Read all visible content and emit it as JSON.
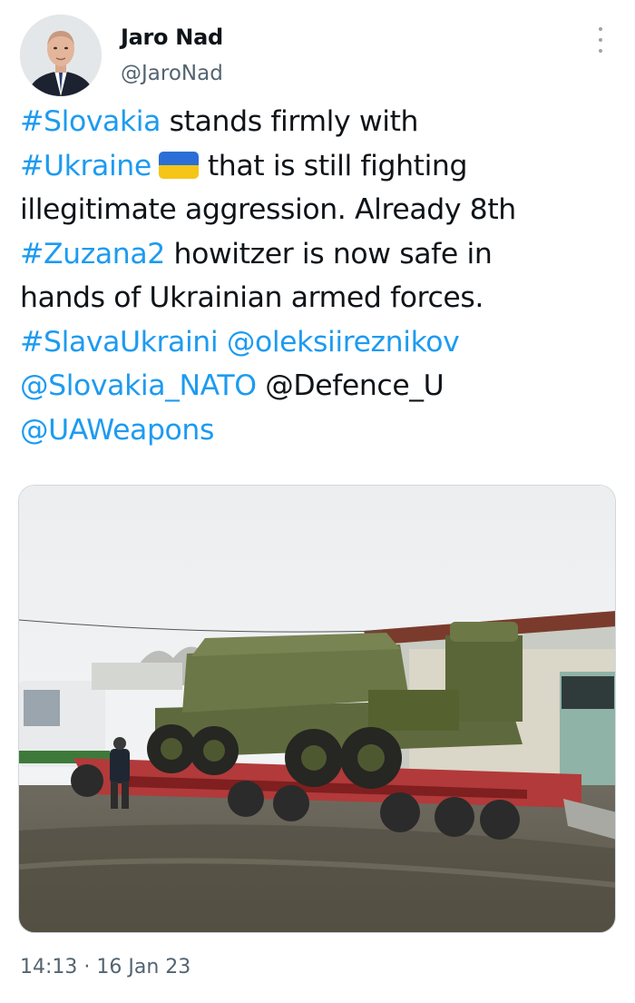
{
  "author": {
    "name": "Jaro Nad",
    "handle": "@JaroNad"
  },
  "tweet": {
    "segments": {
      "tag_slovakia": "#Slovakia",
      "text_1": " stands firmly with",
      "tag_ukraine": "#Ukraine",
      "flag_icon": "ukraine-flag-emoji",
      "text_2": "that is still fighting",
      "text_3": "illegitimate aggression. Already 8th",
      "tag_zuzana2": "#Zuzana2",
      "text_4": " howitzer is now safe in",
      "text_5": "hands of Ukrainian armed forces.",
      "tag_slavaukraini": "#SlavaUkraini",
      "mention_oleksii": "@oleksiireznikov",
      "mention_slovakia_nato": "@Slovakia_NATO",
      "text_6": " @Defence_U",
      "mention_uaweapons": "@UAWeapons"
    }
  },
  "media": {
    "alt": "Zuzana 2 howitzer on a low-loader truck trailer"
  },
  "timestamp": "14:13 · 16 Jan 23",
  "colors": {
    "link": "#1d9bf0",
    "text": "#0f1419",
    "secondary": "#536471",
    "flag_blue": "#2b6fd6",
    "flag_yellow": "#f5c518"
  }
}
